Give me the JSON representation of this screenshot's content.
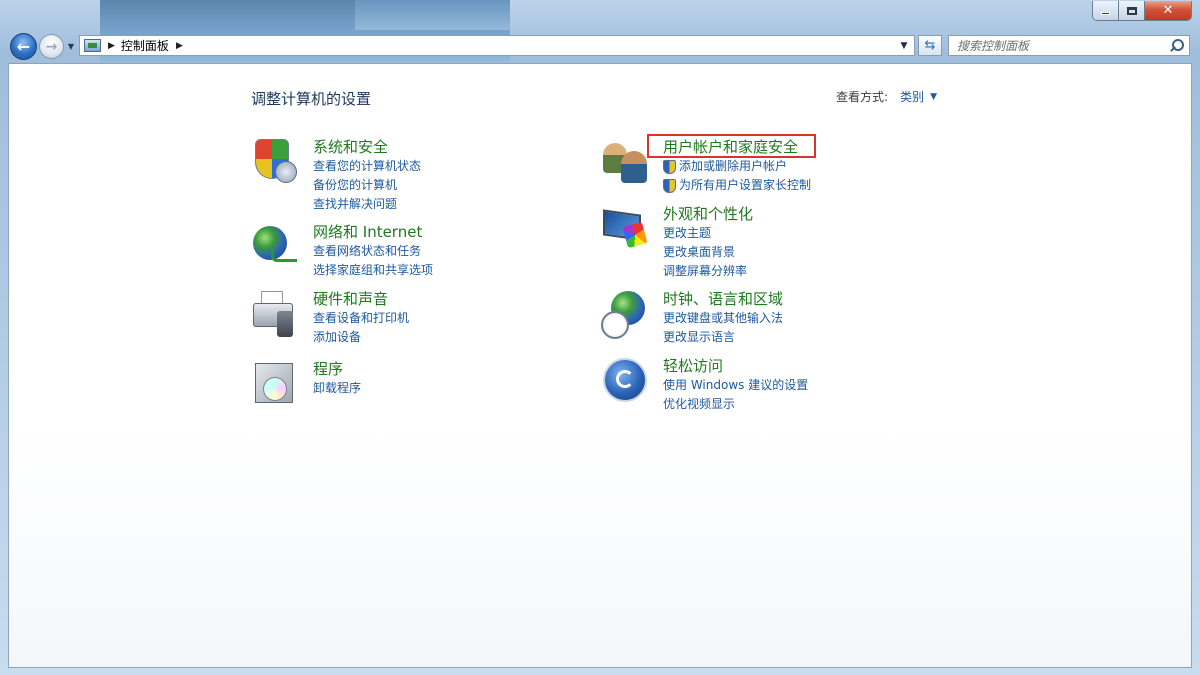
{
  "window": {
    "caption_buttons": {
      "minimize": "minimize",
      "maximize": "maximize",
      "close": "close"
    }
  },
  "nav": {
    "breadcrumb": "控制面板",
    "search_placeholder": "搜索控制面板"
  },
  "main": {
    "title": "调整计算机的设置",
    "view_by_label": "查看方式:",
    "view_by_value": "类别"
  },
  "categories": {
    "system": {
      "icon": "security-shield-icon",
      "title": "系统和安全",
      "links": [
        "查看您的计算机状态",
        "备份您的计算机",
        "查找并解决问题"
      ]
    },
    "network": {
      "icon": "network-globe-icon",
      "title": "网络和 Internet",
      "links": [
        "查看网络状态和任务",
        "选择家庭组和共享选项"
      ]
    },
    "hardware": {
      "icon": "printer-speaker-icon",
      "title": "硬件和声音",
      "links": [
        "查看设备和打印机",
        "添加设备"
      ]
    },
    "programs": {
      "icon": "programs-disc-icon",
      "title": "程序",
      "links": [
        "卸载程序"
      ]
    },
    "users": {
      "icon": "users-icon",
      "title": "用户帐户和家庭安全",
      "links": [
        "添加或删除用户帐户",
        "为所有用户设置家长控制"
      ]
    },
    "appearance": {
      "icon": "monitor-palette-icon",
      "title": "外观和个性化",
      "links": [
        "更改主题",
        "更改桌面背景",
        "调整屏幕分辨率"
      ]
    },
    "clock": {
      "icon": "clock-globe-icon",
      "title": "时钟、语言和区域",
      "links": [
        "更改键盘或其他输入法",
        "更改显示语言"
      ]
    },
    "ease": {
      "icon": "ease-of-access-icon",
      "title": "轻松访问",
      "links": [
        "使用 Windows 建议的设置",
        "优化视频显示"
      ]
    }
  },
  "colors": {
    "category_title": "#1e7a1e",
    "link": "#1e5aa0",
    "highlight": "#d9342b"
  }
}
